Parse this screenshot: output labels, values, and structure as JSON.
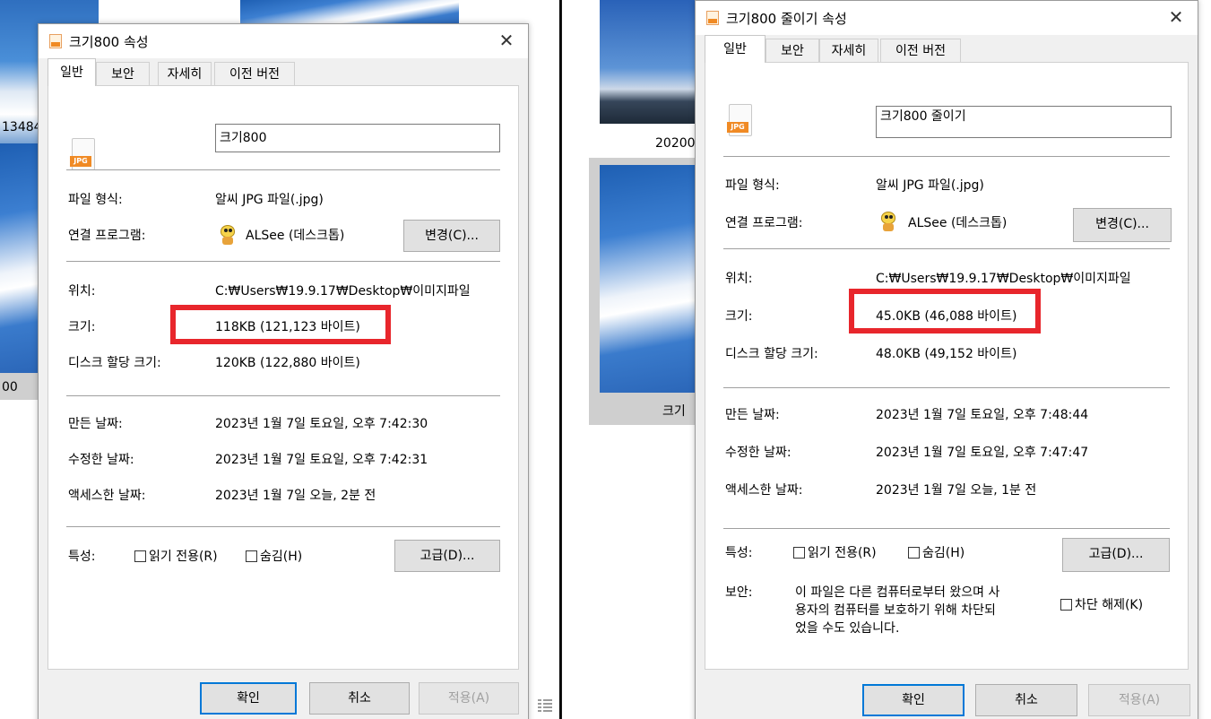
{
  "left": {
    "background": {
      "partial_label_1": "13484",
      "partial_label_2": "00"
    },
    "dialog": {
      "title": "크기800 속성",
      "close_label": "✕",
      "tabs": [
        "일반",
        "보안",
        "자세히",
        "이전 버전"
      ],
      "file_name": "크기800",
      "file_type_label": "파일 형식:",
      "file_type_value": "알씨 JPG 파일(.jpg)",
      "opens_with_label": "연결 프로그램:",
      "opens_with_value": "ALSee (데스크톱)",
      "change_button": "변경(C)...",
      "location_label": "위치:",
      "location_value": "C:₩Users₩19.9.17₩Desktop₩이미지파일",
      "size_label": "크기:",
      "size_value": "118KB (121,123 바이트)",
      "size_on_disk_label": "디스크 할당 크기:",
      "size_on_disk_value": "120KB (122,880 바이트)",
      "created_label": "만든 날짜:",
      "created_value": "2023년 1월 7일 토요일, 오후 7:42:30",
      "modified_label": "수정한 날짜:",
      "modified_value": "2023년 1월 7일 토요일, 오후 7:42:31",
      "accessed_label": "액세스한 날짜:",
      "accessed_value": "2023년 1월 7일 오늘, 2분 전",
      "attributes_label": "특성:",
      "readonly_label": "읽기 전용(R)",
      "hidden_label": "숨김(H)",
      "advanced_button": "고급(D)...",
      "ok_button": "확인",
      "cancel_button": "취소",
      "apply_button": "적용(A)"
    }
  },
  "right": {
    "background": {
      "thumb_label_1": "20200",
      "thumb_label_2": "크기"
    },
    "dialog": {
      "title": "크기800 줄이기 속성",
      "close_label": "✕",
      "tabs": [
        "일반",
        "보안",
        "자세히",
        "이전 버전"
      ],
      "file_name": "크기800 줄이기",
      "file_type_label": "파일 형식:",
      "file_type_value": "알씨 JPG 파일(.jpg)",
      "opens_with_label": "연결 프로그램:",
      "opens_with_value": "ALSee (데스크톱)",
      "change_button": "변경(C)...",
      "location_label": "위치:",
      "location_value": "C:₩Users₩19.9.17₩Desktop₩이미지파일",
      "size_label": "크기:",
      "size_value": "45.0KB (46,088 바이트)",
      "size_on_disk_label": "디스크 할당 크기:",
      "size_on_disk_value": "48.0KB (49,152 바이트)",
      "created_label": "만든 날짜:",
      "created_value": "2023년 1월 7일 토요일, 오후 7:48:44",
      "modified_label": "수정한 날짜:",
      "modified_value": "2023년 1월 7일 토요일, 오후 7:47:47",
      "accessed_label": "액세스한 날짜:",
      "accessed_value": "2023년 1월 7일 오늘, 1분 전",
      "attributes_label": "특성:",
      "readonly_label": "읽기 전용(R)",
      "hidden_label": "숨김(H)",
      "advanced_button": "고급(D)...",
      "security_label": "보안:",
      "security_text_1": "이 파일은 다른 컴퓨터로부터 왔으며 사",
      "security_text_2": "용자의 컴퓨터를 보호하기 위해 차단되",
      "security_text_3": "었을 수도 있습니다.",
      "unblock_label": "차단 해제(K)",
      "ok_button": "확인",
      "cancel_button": "취소",
      "apply_button": "적용(A)"
    }
  },
  "icons": {
    "file_icon_badge": "JPG"
  },
  "colors": {
    "highlight": "#e8262c",
    "default_button_border": "#0078d7"
  }
}
